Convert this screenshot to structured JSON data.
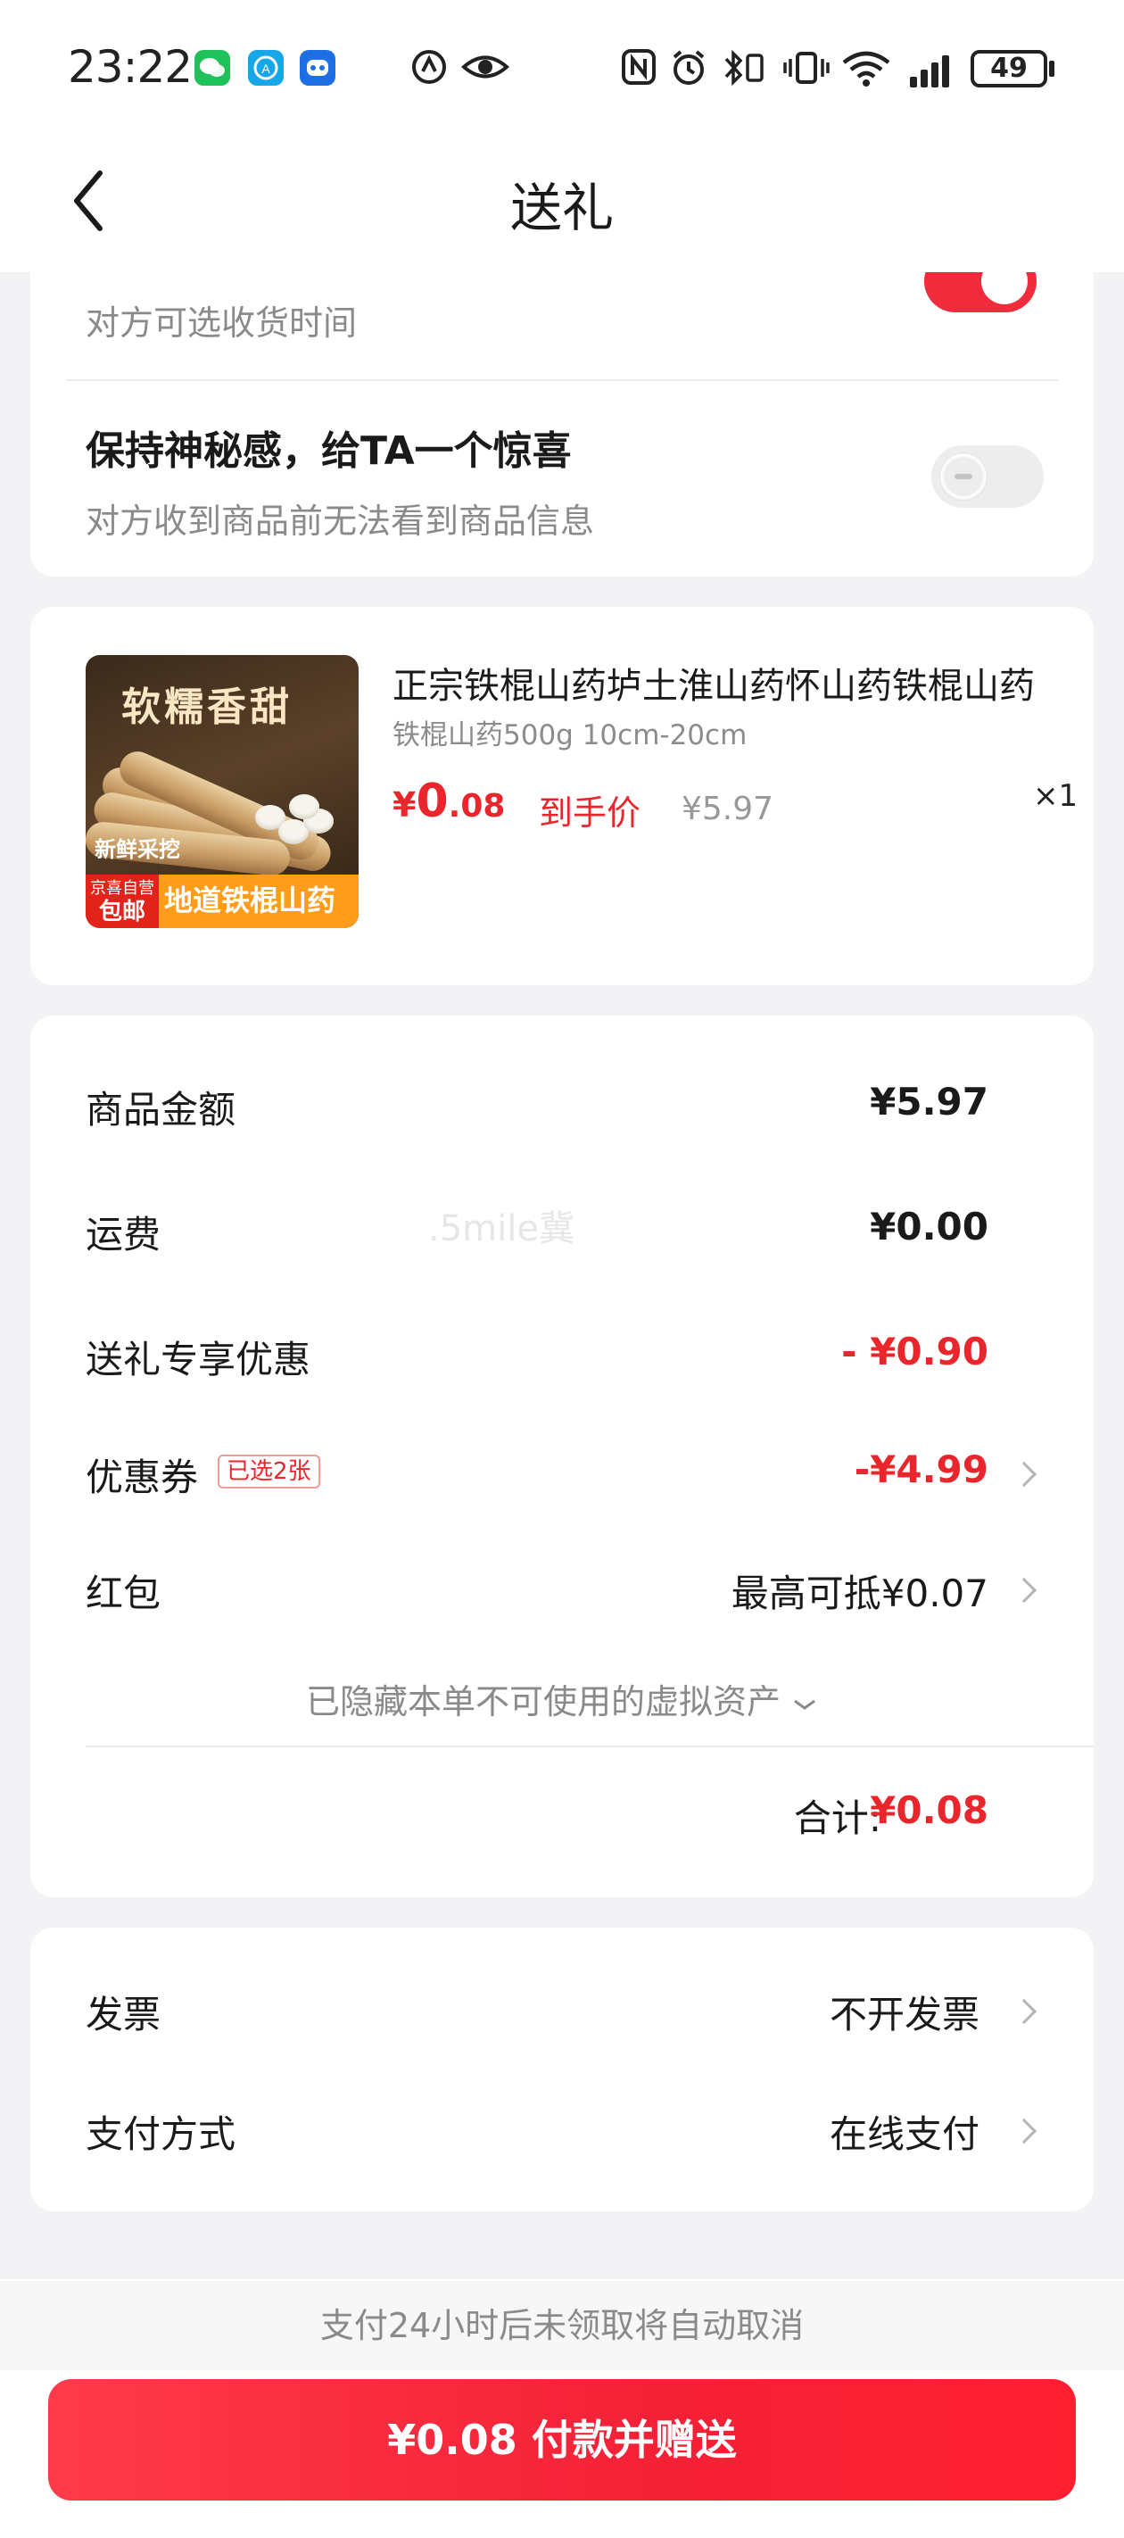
{
  "status_bar": {
    "time": "23:22",
    "battery": "49"
  },
  "nav": {
    "title": "送礼"
  },
  "options": {
    "delivery_time_sub": "对方可选收货时间",
    "delivery_time_on": true,
    "mystery_title": "保持神秘感，给TA一个惊喜",
    "mystery_sub": "对方收到商品前无法看到商品信息",
    "mystery_on": false
  },
  "product": {
    "image_banner": "软糯香甜",
    "image_fresh": "新鲜采挖",
    "image_tag_top": "京喜自营",
    "image_tag_bottom": "包邮",
    "image_bottom_text": "地道铁棍山药",
    "name": "正宗铁棍山药垆土淮山药怀山药铁棍山药",
    "spec": "铁棍山药500g 10cm-20cm",
    "price_symbol": "¥",
    "price_int": "0",
    "price_dec": ".08",
    "price_label": "到手价",
    "original_price": "¥5.97",
    "quantity": "×1"
  },
  "amounts": {
    "goods_label": "商品金额",
    "goods_value": "¥5.97",
    "shipping_label": "运费",
    "shipping_value": "¥0.00",
    "gift_discount_label": "送礼专享优惠",
    "gift_discount_value": "- ¥0.90",
    "coupon_label": "优惠券",
    "coupon_badge": "已选2张",
    "coupon_value": "-¥4.99",
    "redpacket_label": "红包",
    "redpacket_value": "最高可抵¥0.07",
    "hidden_note": "已隐藏本单不可使用的虚拟资产",
    "total_label": "合计:",
    "total_value": "¥0.08"
  },
  "watermark": ".5mile冀",
  "extras": {
    "invoice_label": "发票",
    "invoice_value": "不开发票",
    "payment_label": "支付方式",
    "payment_value": "在线支付"
  },
  "footer": {
    "note": "支付24小时后未领取将自动取消",
    "pay_button": "¥0.08 付款并赠送"
  },
  "colors": {
    "accent": "#e8262c",
    "button": "#f42036",
    "background": "#f3f3f5"
  }
}
